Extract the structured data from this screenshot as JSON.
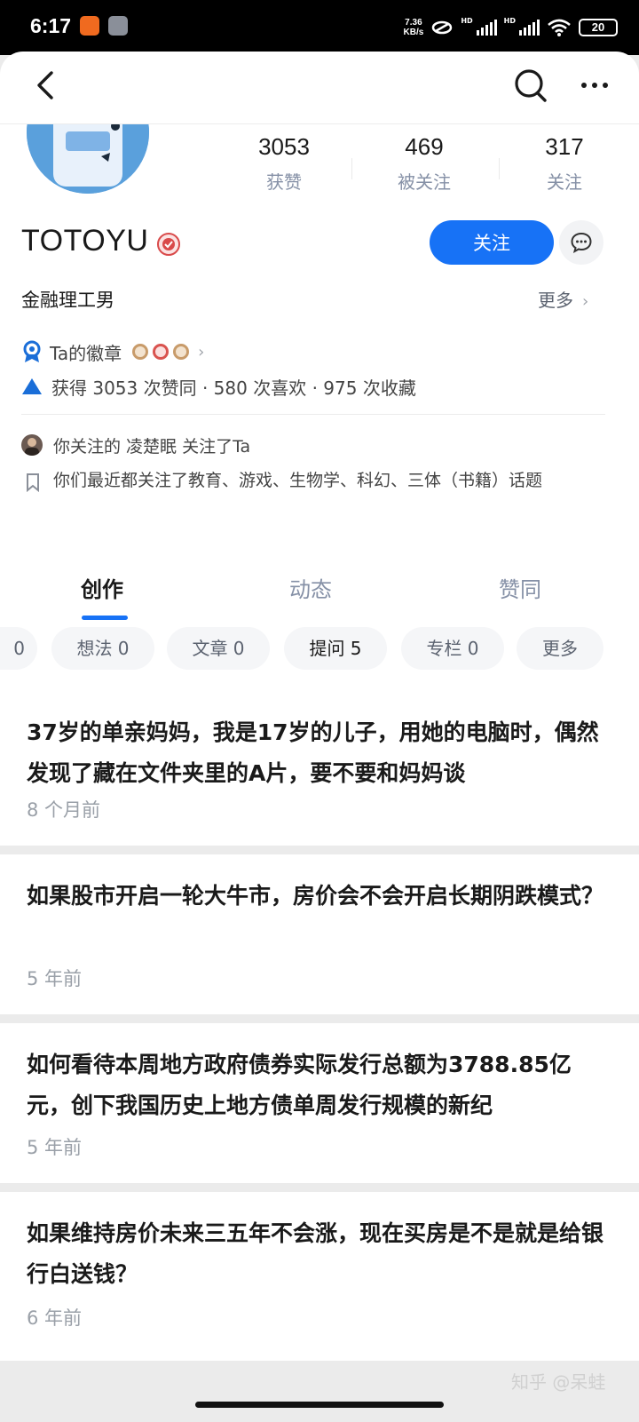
{
  "status_bar": {
    "time": "6:17",
    "net_speed_value": "7.36",
    "net_speed_unit": "KB/s",
    "sim1_tag": "HD",
    "sim2_tag": "HD",
    "battery": "20"
  },
  "header": {
    "back_icon": "back-arrow-icon",
    "search_icon": "search-icon",
    "more_icon": "more-dots-icon"
  },
  "profile": {
    "stats": [
      {
        "value": "3053",
        "label": "获赞"
      },
      {
        "value": "469",
        "label": "被关注"
      },
      {
        "value": "317",
        "label": "关注"
      }
    ],
    "name": "TOTOYU",
    "follow_label": "关注",
    "bio": "金融理工男",
    "more_label": "更多",
    "badges_label": "Ta的徽章",
    "likes_summary": "获得 3053 次赞同 · 580 次喜欢 · 975 次收藏",
    "mutual_text": "你关注的 凌楚眠 关注了Ta",
    "common_topics": "你们最近都关注了教育、游戏、生物学、科幻、三体（书籍）话题"
  },
  "tabs": [
    {
      "label": "创作",
      "active": true
    },
    {
      "label": "动态",
      "active": false
    },
    {
      "label": "赞同",
      "active": false
    }
  ],
  "chips": [
    {
      "label": "0"
    },
    {
      "label": "想法 0"
    },
    {
      "label": "文章 0"
    },
    {
      "label": "提问 5"
    },
    {
      "label": "专栏 0"
    },
    {
      "label": "更多"
    }
  ],
  "questions": [
    {
      "title": "37岁的单亲妈妈，我是17岁的儿子，用她的电脑时，偶然发现了藏在文件夹里的A片，要不要和妈妈谈",
      "time": "8 个月前"
    },
    {
      "title": "如果股市开启一轮大牛市，房价会不会开启长期阴跌模式？",
      "time": "5 年前"
    },
    {
      "title": "如何看待本周地方政府债券实际发行总额为3788.85亿元，创下我国历史上地方债单周发行规模的新纪",
      "time": "5 年前"
    },
    {
      "title": "如果维持房价未来三五年不会涨，现在买房是不是就是给银行白送钱？",
      "time": "6 年前"
    }
  ],
  "watermark": "知乎 @呆蛙",
  "colors": {
    "accent": "#1772f6",
    "badge_icon": "#1a6ed8",
    "verify_badge": "#d94a4a",
    "muted_text": "#8590a6"
  }
}
